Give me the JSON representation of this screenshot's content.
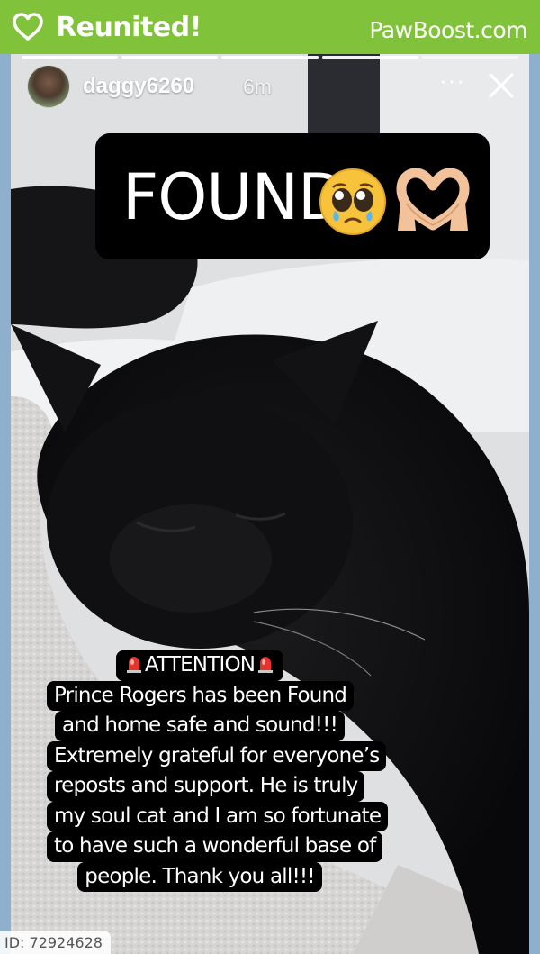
{
  "banner": {
    "title": "Reunited!",
    "brand": "PawBoost.com",
    "color": "#80c33a"
  },
  "story": {
    "username": "daggy6260",
    "time": "6m",
    "more_label": "···",
    "progress_segments": 5,
    "overlay_text": "FOUND",
    "overlay_emojis": [
      "pleading-face-emoji",
      "heart-hands-emoji"
    ],
    "caption": {
      "heading": "ATTENTION",
      "lines": [
        "Prince Rogers has been Found",
        "and home safe and sound!!!",
        "Extremely grateful for everyone’s",
        "reposts and support. He is truly",
        "my soul cat and I am so fortunate",
        "to have such a wonderful base of",
        "people. Thank you all!!!"
      ]
    }
  },
  "listing": {
    "id_label": "ID: 72924628"
  },
  "icons": {
    "banner": "heart-outline-icon",
    "close": "close-icon",
    "more": "more-options-icon",
    "siren": "siren-emoji"
  }
}
